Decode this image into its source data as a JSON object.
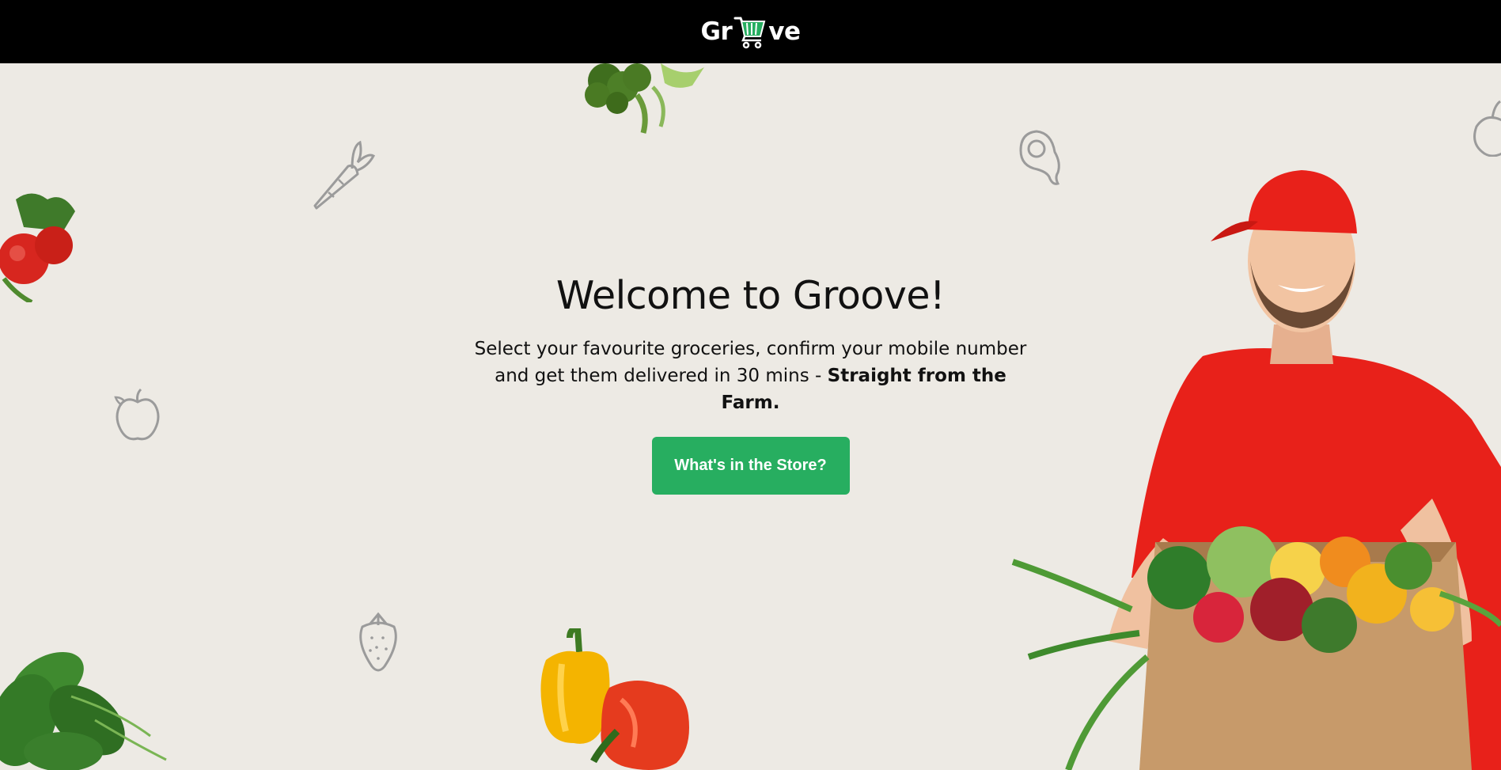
{
  "header": {
    "logo_left": "Gr",
    "logo_right": "ve",
    "logo_icon": "shopping-cart-icon"
  },
  "hero": {
    "title": "Welcome to Groove!",
    "subtitle_line1": "Select your favourite groceries, confirm your mobile number",
    "subtitle_line2_plain": "and get them delivered in 30 mins - ",
    "subtitle_line2_bold": "Straight from the Farm.",
    "cta_label": "What's in the Store?"
  },
  "colors": {
    "background": "#edeae4",
    "header": "#000000",
    "accent": "#27ae60"
  }
}
